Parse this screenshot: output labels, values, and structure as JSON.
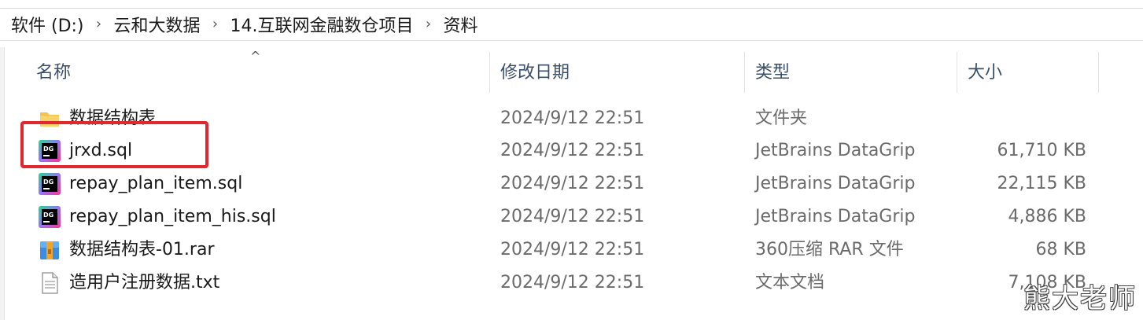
{
  "breadcrumb": {
    "items": [
      "软件 (D:)",
      "云和大数据",
      "14.互联网金融数仓项目",
      "资料"
    ],
    "separator": "›"
  },
  "columns": {
    "name": "名称",
    "modified": "修改日期",
    "type": "类型",
    "size": "大小",
    "sort_indicator": "^"
  },
  "files": [
    {
      "name": "数据结构表",
      "modified": "2024/9/12 22:51",
      "type": "文件夹",
      "size": "",
      "icon": "folder-icon"
    },
    {
      "name": "jrxd.sql",
      "modified": "2024/9/12 22:51",
      "type": "JetBrains DataGrip",
      "size": "61,710 KB",
      "icon": "datagrip-file-icon"
    },
    {
      "name": "repay_plan_item.sql",
      "modified": "2024/9/12 22:51",
      "type": "JetBrains DataGrip",
      "size": "22,115 KB",
      "icon": "datagrip-file-icon"
    },
    {
      "name": "repay_plan_item_his.sql",
      "modified": "2024/9/12 22:51",
      "type": "JetBrains DataGrip",
      "size": "4,886 KB",
      "icon": "datagrip-file-icon"
    },
    {
      "name": "数据结构表-01.rar",
      "modified": "2024/9/12 22:51",
      "type": "360压缩 RAR 文件",
      "size": "68 KB",
      "icon": "rar-archive-icon"
    },
    {
      "name": "造用户注册数据.txt",
      "modified": "2024/9/12 22:51",
      "type": "文本文档",
      "size": "7,108 KB",
      "icon": "text-file-icon"
    }
  ],
  "watermark": "熊大老师",
  "colors": {
    "highlight": "#e0282e",
    "header_text": "#3b4f6a",
    "secondary_text": "#6b6b6b",
    "folder": "#f2c14e"
  }
}
